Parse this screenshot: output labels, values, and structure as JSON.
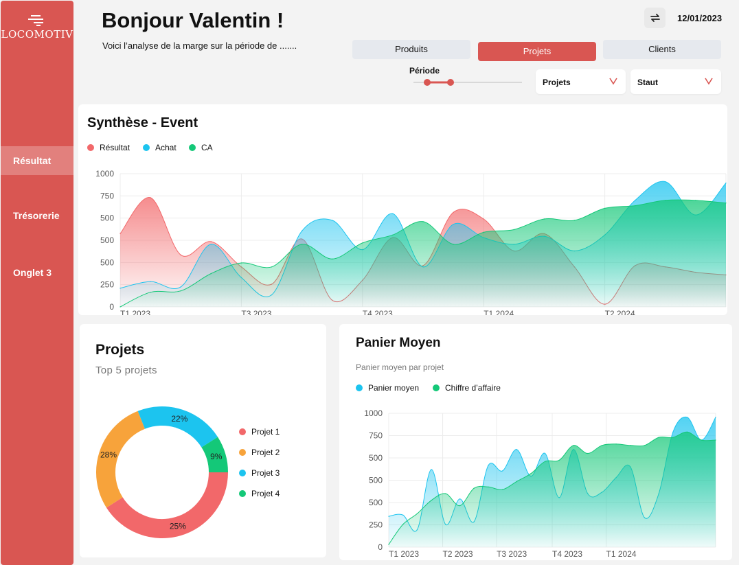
{
  "sidebar": {
    "logo": "LOCOMOTIV",
    "items": [
      {
        "label": "Résultat",
        "active": true
      },
      {
        "label": "Trésorerie",
        "active": false
      },
      {
        "label": "Onglet 3",
        "active": false
      }
    ]
  },
  "header": {
    "greeting": "Bonjour Valentin !",
    "subtitle": "Voici l’analyse de la marge sur la période de .......",
    "date": "12/01/2023",
    "refresh_icon": "refresh-icon"
  },
  "tabs": [
    {
      "label": "Produits",
      "active": false
    },
    {
      "label": "Projets",
      "active": true
    },
    {
      "label": "Clients",
      "active": false
    }
  ],
  "filters": {
    "periode_label": "Période",
    "dropdown_projets": "Projets",
    "dropdown_statut": "Staut"
  },
  "colors": {
    "accent": "#d95652",
    "red": "#f2686a",
    "blue": "#1cc4ef",
    "green": "#14c878",
    "orange": "#f7a33b"
  },
  "synthese": {
    "title": "Synthèse - Event",
    "legend": [
      "Résultat",
      "Achat",
      "CA"
    ]
  },
  "projets": {
    "title": "Projets",
    "subtitle": "Top 5 projets",
    "legend": [
      "Projet 1",
      "Projet 2",
      "Projet 3",
      "Projet 4"
    ]
  },
  "panier": {
    "title": "Panier Moyen",
    "subtitle": "Panier moyen par projet",
    "legend": [
      "Panier moyen",
      "Chiffre d’affaire"
    ]
  },
  "chart_data": [
    {
      "type": "area",
      "title": "Synthèse - Event",
      "yticks": [
        "1000",
        "750",
        "500",
        "500",
        "500",
        "250",
        "0"
      ],
      "xticks": [
        "T1 2023",
        "T3 2023",
        "T4 2023",
        "T1 2024",
        "T2 2024"
      ],
      "ylim": [
        0,
        1000
      ],
      "grid": true,
      "legend_placement": "top-left",
      "x": [
        0,
        0.25,
        0.5,
        0.75,
        1,
        1.25,
        1.5,
        1.75,
        2,
        2.25,
        2.5,
        2.75,
        3,
        3.25,
        3.5,
        3.75,
        4,
        4.25,
        4.5,
        4.75,
        5
      ],
      "series": [
        {
          "name": "Résultat",
          "color": "#f2686a",
          "values": [
            550,
            820,
            390,
            490,
            300,
            170,
            510,
            50,
            200,
            520,
            310,
            710,
            660,
            420,
            550,
            300,
            20,
            310,
            300,
            260,
            240
          ]
        },
        {
          "name": "Achat",
          "color": "#1cc4ef",
          "values": [
            140,
            190,
            150,
            470,
            220,
            90,
            570,
            650,
            430,
            700,
            300,
            620,
            520,
            470,
            530,
            420,
            540,
            800,
            940,
            690,
            930
          ]
        },
        {
          "name": "CA",
          "color": "#14c878",
          "values": [
            0,
            110,
            120,
            250,
            330,
            300,
            470,
            360,
            480,
            540,
            640,
            470,
            560,
            580,
            660,
            650,
            740,
            760,
            800,
            800,
            780
          ]
        }
      ]
    },
    {
      "type": "pie",
      "title": "Projets",
      "slices": [
        {
          "name": "Projet 1",
          "label": "25%",
          "value": 41,
          "color": "#f2686a"
        },
        {
          "name": "Projet 2",
          "label": "28%",
          "value": 28,
          "color": "#f7a33b"
        },
        {
          "name": "Projet 3",
          "label": "22%",
          "value": 22,
          "color": "#1cc4ef"
        },
        {
          "name": "Projet 4",
          "label": "9%",
          "value": 9,
          "color": "#14c878"
        }
      ]
    },
    {
      "type": "area",
      "title": "Panier Moyen",
      "yticks": [
        "1000",
        "750",
        "500",
        "500",
        "500",
        "250",
        "0"
      ],
      "xticks": [
        "T1 2023",
        "T2 2023",
        "T3 2023",
        "T4 2023",
        "T1 2024"
      ],
      "ylim": [
        0,
        1000
      ],
      "grid": true,
      "legend_placement": "top-left",
      "x": [
        0,
        0.2,
        0.4,
        0.6,
        0.8,
        1,
        1.2,
        1.4,
        1.6,
        1.8,
        2,
        2.2,
        2.4,
        2.6,
        2.8,
        3,
        3.2,
        3.4,
        3.6,
        3.8,
        4,
        4.2,
        4.4,
        4.6
      ],
      "series": [
        {
          "name": "Panier moyen",
          "color": "#1cc4ef",
          "values": [
            230,
            240,
            130,
            580,
            170,
            360,
            190,
            610,
            570,
            730,
            530,
            700,
            370,
            730,
            400,
            410,
            520,
            600,
            220,
            400,
            860,
            970,
            800,
            970
          ]
        },
        {
          "name": "Chiffre d’affaire",
          "color": "#14c878",
          "values": [
            20,
            170,
            250,
            350,
            400,
            310,
            440,
            450,
            430,
            490,
            550,
            640,
            650,
            760,
            700,
            760,
            770,
            760,
            760,
            820,
            820,
            860,
            800,
            800
          ]
        }
      ]
    }
  ]
}
